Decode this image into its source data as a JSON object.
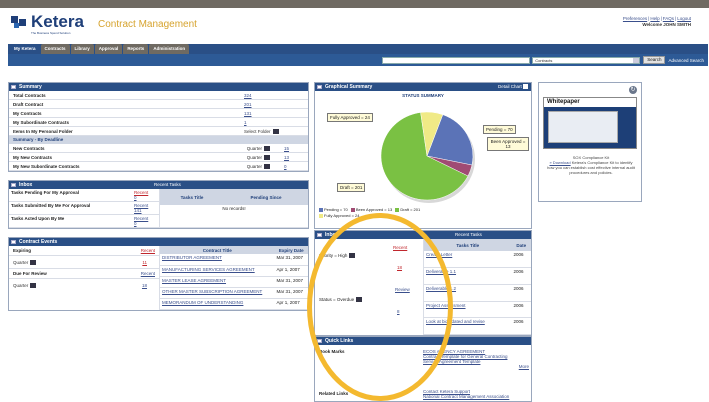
{
  "header": {
    "logo": "Ketera",
    "logo_tagline": "The Business Spend Solution",
    "app_title": "Contract Management",
    "links": [
      "Preferences",
      "Help",
      "FAQs",
      "Logout"
    ],
    "welcome": "Welcome JOHN SMITH"
  },
  "tabs": [
    "My Ketera",
    "Contracts",
    "Library",
    "Approval",
    "Reports",
    "Administration"
  ],
  "search": {
    "select_value": "Contracts",
    "button": "Search",
    "advanced": "Advanced Search"
  },
  "summary": {
    "title": "Summary",
    "rows": [
      {
        "label": "Total Contracts",
        "value": "324"
      },
      {
        "label": "Draft Contract",
        "value": "201"
      },
      {
        "label": "My Contracts",
        "value": "131"
      },
      {
        "label": "My Subordinate Contracts",
        "value": "1"
      },
      {
        "label": "Items In My Personal Folder",
        "value": "Select Folder"
      }
    ]
  },
  "summary_deadline": {
    "title": "Summary - By Deadline",
    "rows": [
      {
        "label": "New Contracts",
        "period": "Quarter",
        "value": "15"
      },
      {
        "label": "My New Contracts",
        "period": "Quarter",
        "value": "13"
      },
      {
        "label": "My New Subordinate Contracts",
        "period": "Quarter",
        "value": "0"
      }
    ]
  },
  "inbox": {
    "title": "Inbox",
    "recent_title": "Recent Tasks",
    "rows": [
      {
        "label": "Tasks Pending For My Approval",
        "recent": "Recent",
        "count": "0"
      },
      {
        "label": "Tasks Submitted By Me For Approval",
        "recent": "Recent",
        "count": "141"
      },
      {
        "label": "Tasks Acted Upon By Me",
        "recent": "Recent",
        "count": "0"
      }
    ],
    "col_title": "Tasks Title",
    "col_pending": "Pending Since",
    "empty": "No records!"
  },
  "contract_events": {
    "title": "Contract Events",
    "expiring": "Expiring",
    "quarter": "Quarter",
    "recent": "Recent",
    "count1": "11",
    "due_review": "Due For Review",
    "count2": "18",
    "col_title": "Contract Title",
    "col_expiry": "Expiry Date",
    "rows": [
      {
        "title": "DISTRIBUTOR AGREEMENT",
        "date": "Mar 31, 2007"
      },
      {
        "title": "MANUFACTURING SERVICES AGREEMENT",
        "date": "Apr 1, 2007"
      },
      {
        "title": "MASTER LEASE AGREEMENT",
        "date": "Mar 31, 2007"
      },
      {
        "title": "OTHER MASTER SUBSCRIPTION AGREEMENT",
        "date": "Mar 31, 2007"
      },
      {
        "title": "MEMORANDUM OF UNDERSTANDING",
        "date": "Apr 1, 2007"
      }
    ]
  },
  "graphical": {
    "title": "Graphical Summary",
    "detail": "Detail Chart",
    "chart_title": "STATUS SUMMARY",
    "callouts": {
      "fully": "Fully Approved = 24",
      "pending": "Pending = 70",
      "been": "Been Approved = 13",
      "draft": "Draft = 201"
    },
    "legend": [
      "Pending = 70",
      "Been Approved = 13",
      "Draft = 201",
      "Fully Approved = 24"
    ]
  },
  "chart_data": {
    "type": "pie",
    "title": "STATUS SUMMARY",
    "categories": [
      "Pending",
      "Been Approved",
      "Draft",
      "Fully Approved"
    ],
    "values": [
      70,
      13,
      201,
      24
    ],
    "colors": [
      "#5b73b7",
      "#a04b73",
      "#7ac143",
      "#f0ea86"
    ]
  },
  "whitepaper": {
    "header": "Whitepaper",
    "text_before": "SOX Compliance Kit",
    "link": "» Download",
    "text_after": "Ketera's Compliance Kit to identify how you can establish cost effective internal audit procedures and policies."
  },
  "inbox2": {
    "title": "Inbox",
    "recent_title": "Recent Tasks",
    "priority": "Priority = High",
    "recent": "Recent",
    "count1": "18",
    "review": "Review",
    "overdue": "Status = Overdue",
    "count2": "8",
    "col_title": "Tasks Title",
    "col_date": "Date",
    "tasks": [
      "Create Letter",
      "Deliverable 1.1",
      "Deliverable 1.2",
      "Project Assessment",
      "Look at bids dated and revise"
    ],
    "dates": [
      "2006",
      "2006",
      "2006",
      "2006",
      "2006"
    ]
  },
  "quick_links": {
    "title": "Quick Links",
    "bookmarks_label": "Book Marks",
    "bookmarks": [
      "ECOS AGENCY AGREEMENT",
      "Contract Template for General Contracting",
      "Service Agreement Template"
    ],
    "more": "More",
    "related_label": "Related Links",
    "related": [
      "Contact Ketera Support",
      "National Contract Management Association"
    ]
  }
}
